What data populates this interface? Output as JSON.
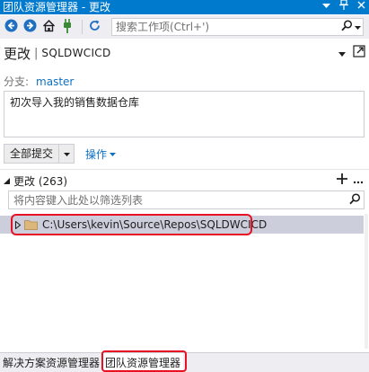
{
  "window": {
    "title": "团队资源管理器 - 更改",
    "title_icons": [
      "dropdown-arrow-icon",
      "pin-icon",
      "close-icon"
    ]
  },
  "toolbar": {
    "buttons": [
      "back-icon",
      "forward-icon",
      "home-icon",
      "plug-icon",
      "refresh-icon"
    ],
    "search_placeholder": "搜索工作项(Ctrl+')"
  },
  "header": {
    "page_title": "更改",
    "divider": "|",
    "repo_name": "SQLDWCICD"
  },
  "branch": {
    "label": "分支:",
    "value": "master"
  },
  "commit": {
    "message": "初次导入我的销售数据仓库",
    "commit_button_label": "全部提交",
    "actions_label": "操作"
  },
  "changes": {
    "title": "更改 (263)",
    "filter_placeholder": "将内容键入此处以筛选列表",
    "items": [
      {
        "path": "C:\\Users\\kevin\\Source\\Repos\\SQLDWCICD"
      }
    ]
  },
  "bottom_tabs": [
    {
      "label": "解决方案资源管理器",
      "active": false
    },
    {
      "label": "团队资源管理器",
      "active": true
    }
  ],
  "colors": {
    "accent": "#007acc",
    "link": "#0e70c0",
    "highlight": "#e81123",
    "selected_row": "#cccedb"
  }
}
